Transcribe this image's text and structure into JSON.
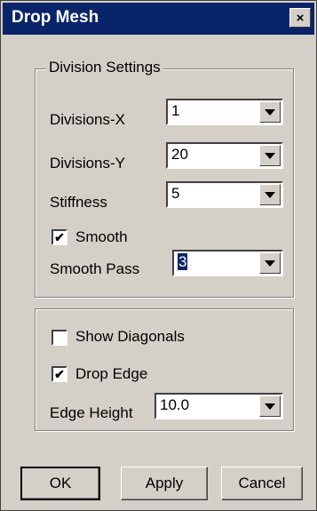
{
  "window": {
    "title": "Drop Mesh",
    "close_symbol": "×"
  },
  "division_settings": {
    "legend": "Division Settings",
    "divisions_x": {
      "label": "Divisions-X",
      "value": "1"
    },
    "divisions_y": {
      "label": "Divisions-Y",
      "value": "20"
    },
    "stiffness": {
      "label": "Stiffness",
      "value": "5"
    },
    "smooth": {
      "label": "Smooth",
      "checked": true
    },
    "smooth_pass": {
      "label": "Smooth Pass",
      "value": "3"
    }
  },
  "edge_settings": {
    "show_diagonals": {
      "label": "Show Diagonals",
      "checked": false
    },
    "drop_edge": {
      "label": "Drop Edge",
      "checked": true
    },
    "edge_height": {
      "label": "Edge Height",
      "value": "10.0"
    }
  },
  "buttons": {
    "ok": "OK",
    "apply": "Apply",
    "cancel": "Cancel"
  },
  "icons": {
    "checkmark": "✔",
    "dropdown": "chevron-down-icon"
  },
  "colors": {
    "titlebar": "#0a246a",
    "face": "#d4d0c8",
    "selection": "#0a246a"
  }
}
